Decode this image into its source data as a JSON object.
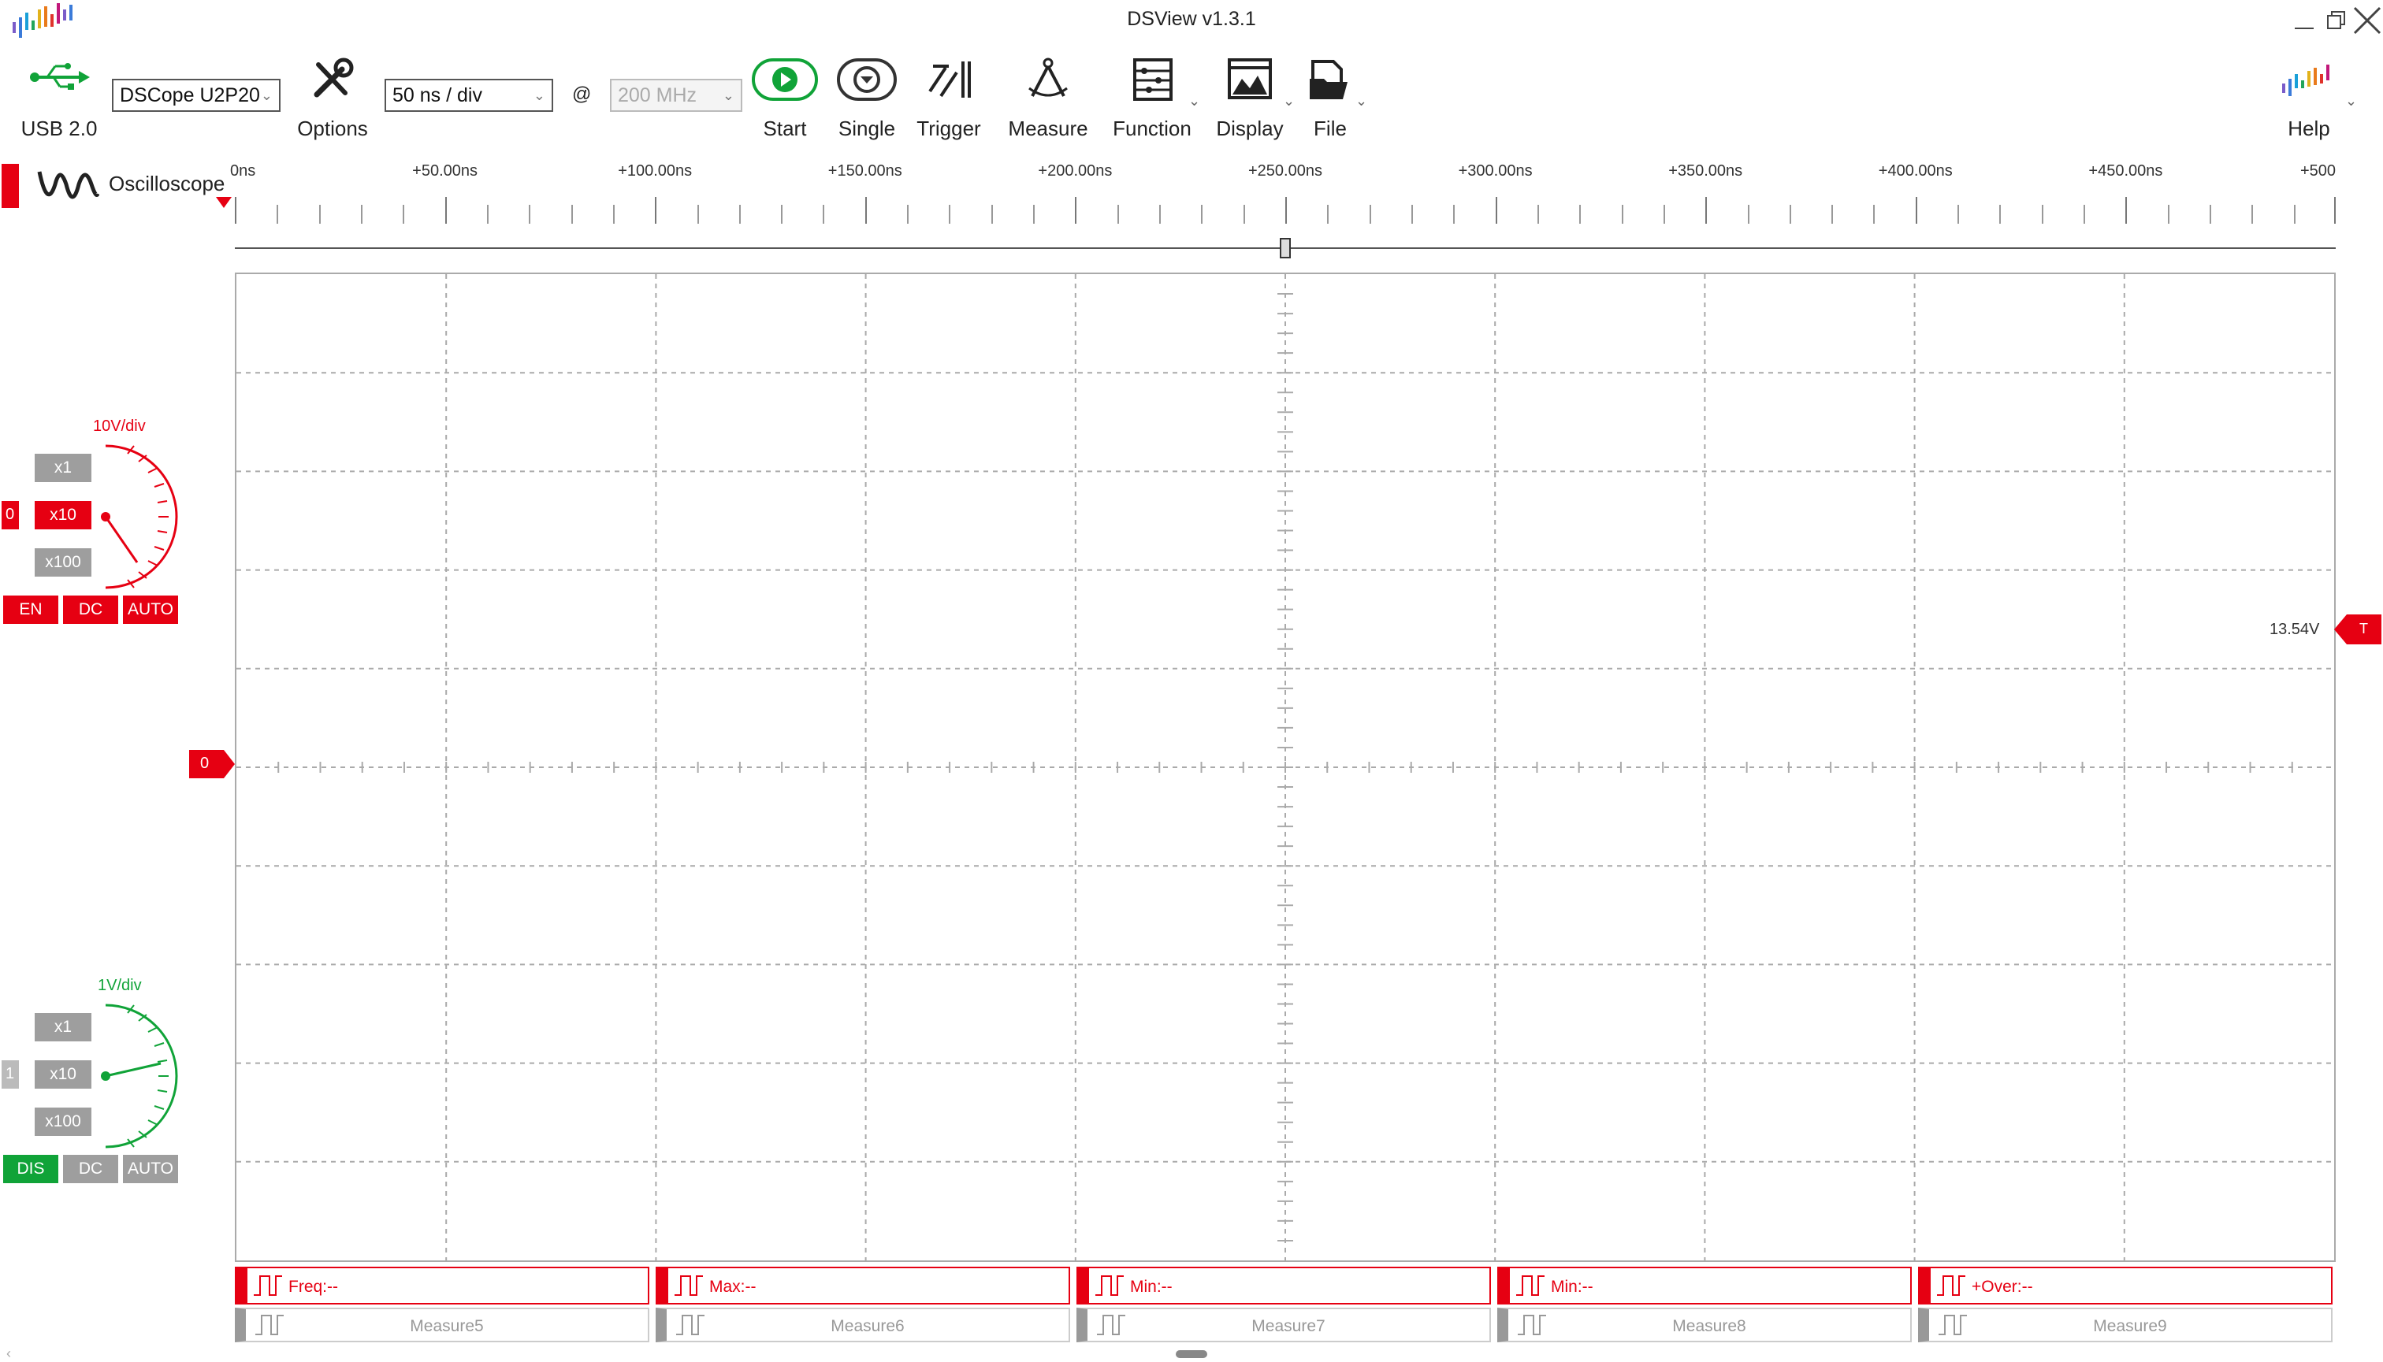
{
  "window": {
    "title": "DSView v1.3.1"
  },
  "toolbar": {
    "usb_label": "USB 2.0",
    "device": "DSCope U2P20",
    "options_label": "Options",
    "timebase": "50 ns / div",
    "at_sign": "@",
    "sample_rate": "200 MHz",
    "start_label": "Start",
    "single_label": "Single",
    "trigger_label": "Trigger",
    "measure_label": "Measure",
    "function_label": "Function",
    "display_label": "Display",
    "file_label": "File",
    "help_label": "Help"
  },
  "mode": {
    "label": "Oscilloscope"
  },
  "ruler": {
    "labels": [
      "0ns",
      "+50.00ns",
      "+100.00ns",
      "+150.00ns",
      "+200.00ns",
      "+250.00ns",
      "+300.00ns",
      "+350.00ns",
      "+400.00ns",
      "+450.00ns",
      "+500"
    ]
  },
  "channels": [
    {
      "index": "0",
      "vdiv": "10V/div",
      "color": "#e60012",
      "probe": [
        "x1",
        "x10",
        "x100"
      ],
      "selected_probe": "x10",
      "enable": "EN",
      "coupling": "DC",
      "auto": "AUTO",
      "offset_marker": "0"
    },
    {
      "index": "1",
      "vdiv": "1V/div",
      "color": "#10a338",
      "probe": [
        "x1",
        "x10",
        "x100"
      ],
      "selected_probe": "x10",
      "enable": "DIS",
      "coupling": "DC",
      "auto": "AUTO"
    }
  ],
  "trigger_level": {
    "value": "13.54V",
    "marker": "T"
  },
  "measures_active": [
    {
      "label": "Freq:--",
      "icon": "freq-icon"
    },
    {
      "label": "Max:--",
      "icon": "max-icon"
    },
    {
      "label": "Min:--",
      "icon": "min-icon"
    },
    {
      "label": "Min:--",
      "icon": "min-icon"
    },
    {
      "label": "+Over:--",
      "icon": "overshoot-icon"
    }
  ],
  "measures_inactive": [
    "Measure5",
    "Measure6",
    "Measure7",
    "Measure8",
    "Measure9"
  ]
}
